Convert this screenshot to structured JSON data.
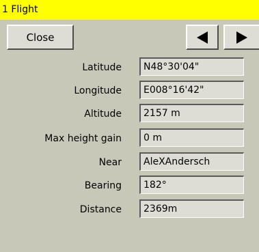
{
  "window": {
    "title": "1 Flight"
  },
  "toolbar": {
    "close_label": "Close",
    "prev_icon": "triangle-left-icon",
    "next_icon": "triangle-right-icon"
  },
  "fields": [
    {
      "label": "Latitude",
      "value": "N48°30'04\""
    },
    {
      "label": "Longitude",
      "value": "E008°16'42\""
    },
    {
      "label": "Altitude",
      "value": "2157 m"
    },
    {
      "label": "Max height gain",
      "value": "0 m"
    },
    {
      "label": "Near",
      "value": "AleXAndersch"
    },
    {
      "label": "Bearing",
      "value": "182°"
    },
    {
      "label": "Distance",
      "value": "2369m"
    }
  ],
  "colors": {
    "titlebar_bg": "#ffff00",
    "panel_bg": "#c8c8b8",
    "button_bg": "#ddddd6"
  }
}
